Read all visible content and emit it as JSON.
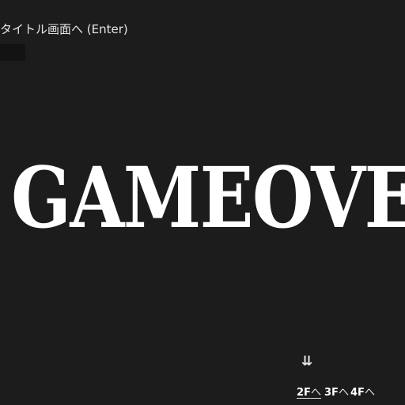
{
  "menu": {
    "title_link_label": "タイトル画面へ (Enter)"
  },
  "main": {
    "gameover_text": "GAMEOVEA"
  },
  "floor_nav": {
    "current_marker": "⇊",
    "items": [
      {
        "num": "2F",
        "suffix": "へ",
        "selected": true
      },
      {
        "num": "3F",
        "suffix": "へ",
        "selected": false
      },
      {
        "num": "4F",
        "suffix": "へ",
        "selected": false
      }
    ]
  },
  "colors": {
    "background": "#1c1c1c",
    "text": "#e6e6e6",
    "gameover": "#ffffff"
  }
}
